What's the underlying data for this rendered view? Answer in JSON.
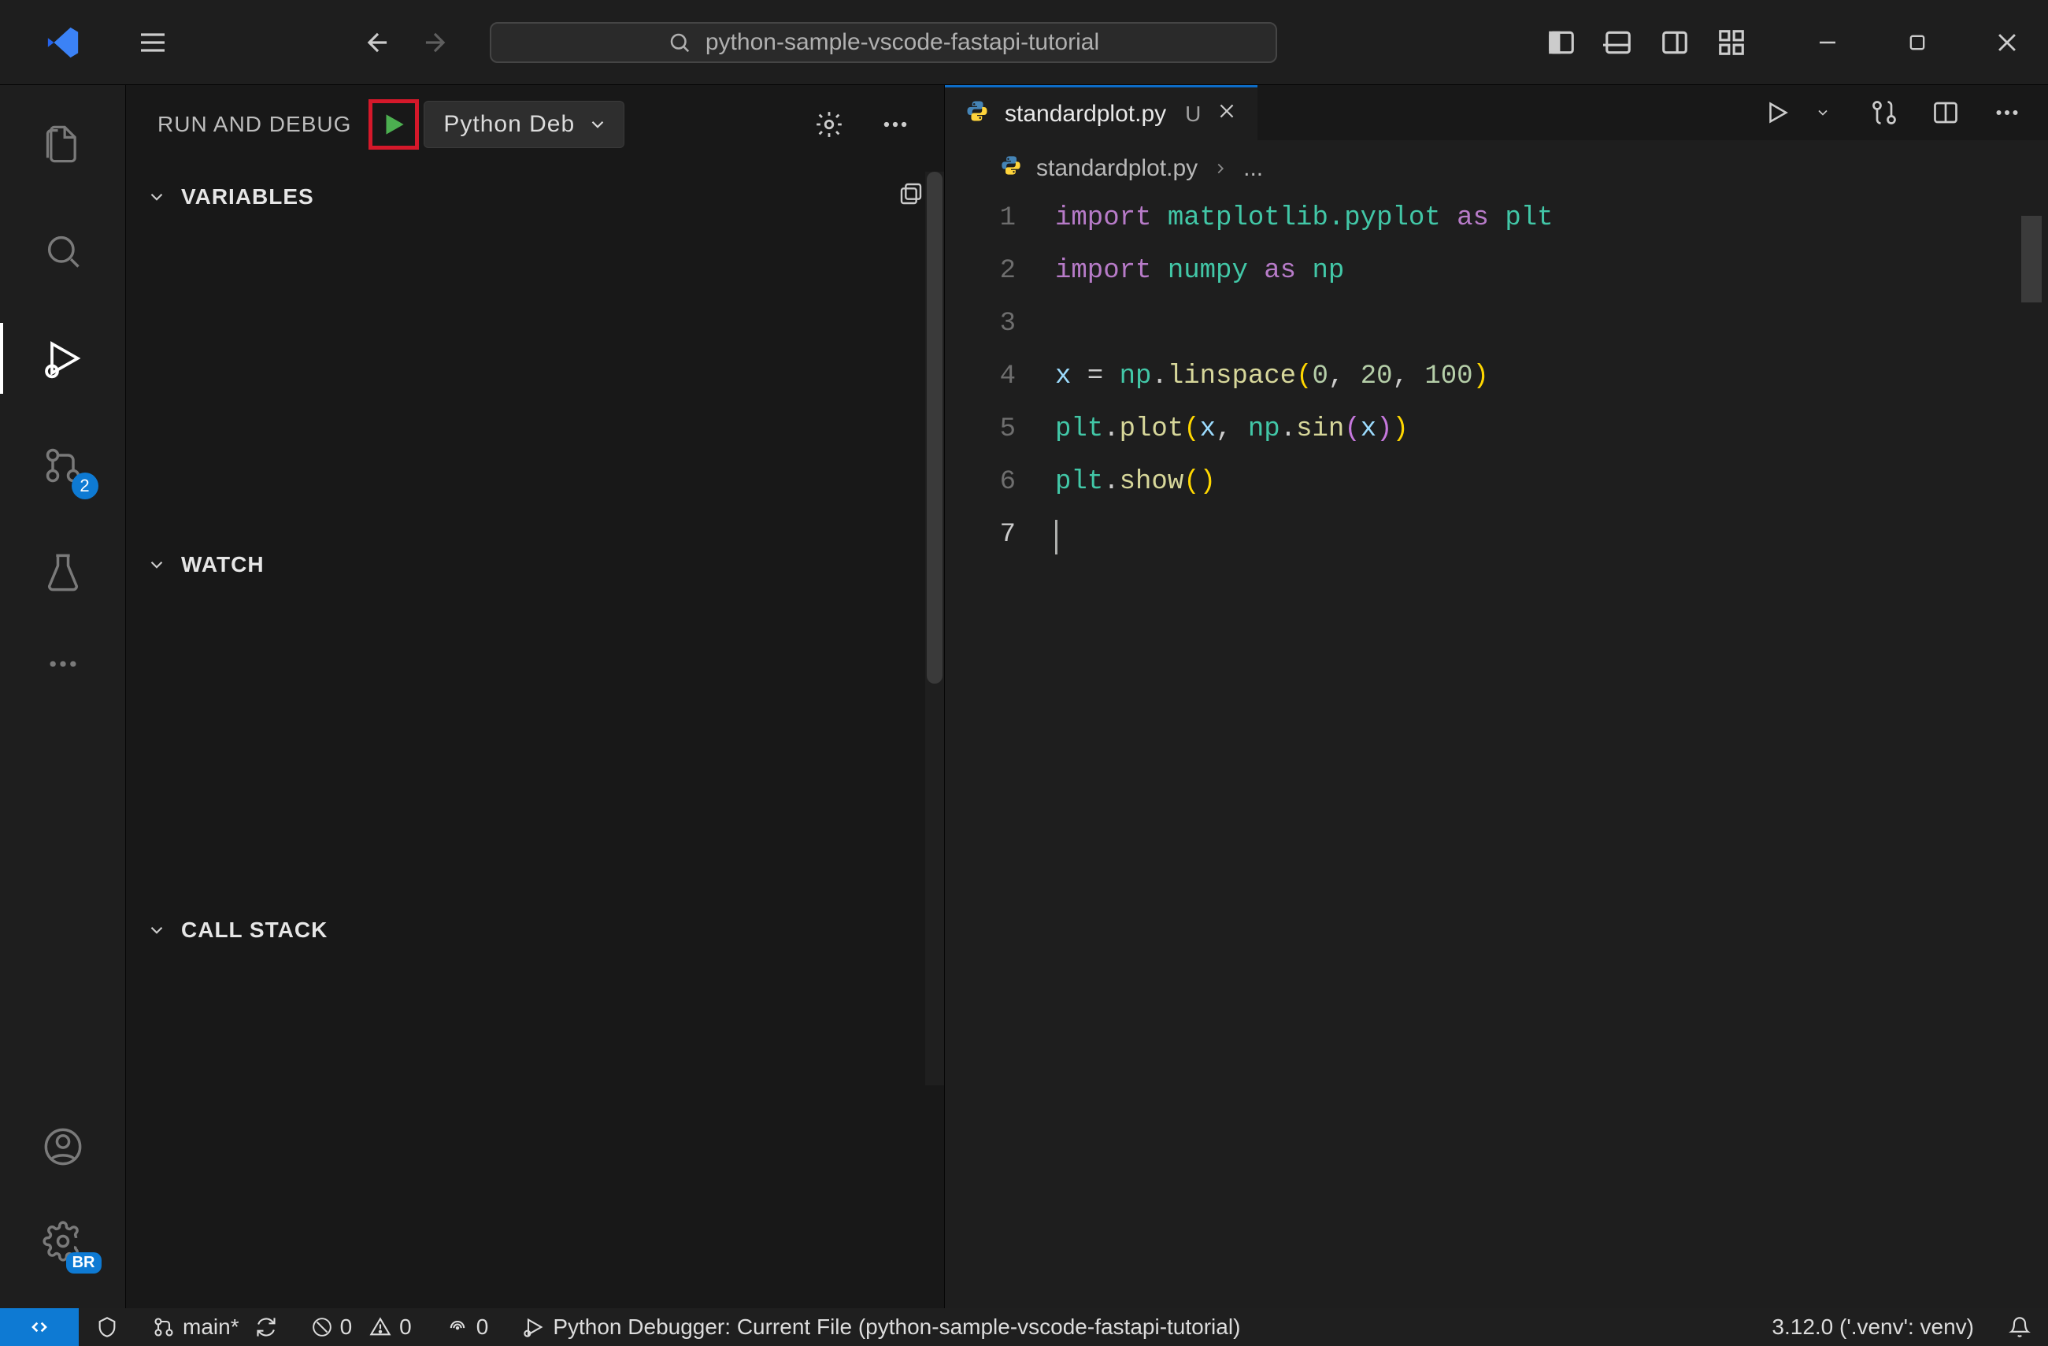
{
  "titlebar": {
    "search_placeholder": "python-sample-vscode-fastapi-tutorial"
  },
  "activity": {
    "scm_badge": "2",
    "settings_tag": "BR"
  },
  "sidebar": {
    "title": "RUN AND DEBUG",
    "config_name": "Python Deb",
    "sections": {
      "variables": "VARIABLES",
      "watch": "WATCH",
      "callstack": "CALL STACK"
    }
  },
  "editor": {
    "tab": {
      "filename": "standardplot.py",
      "modified_marker": "U"
    },
    "breadcrumb": {
      "file": "standardplot.py",
      "more": "..."
    },
    "line_numbers": [
      "1",
      "2",
      "3",
      "4",
      "5",
      "6",
      "7"
    ],
    "code": {
      "l1": {
        "import": "import",
        "module": "matplotlib.pyplot",
        "as": "as",
        "alias": "plt"
      },
      "l2": {
        "import": "import",
        "module": "numpy",
        "as": "as",
        "alias": "np"
      },
      "l4": {
        "x": "x",
        "eq": " = ",
        "np": "np",
        "dot1": ".",
        "linspace": "linspace",
        "op": "(",
        "a": "0",
        "c1": ", ",
        "b": "20",
        "c2": ", ",
        "c": "100",
        "cp": ")"
      },
      "l5": {
        "plt": "plt",
        "dot": ".",
        "plot": "plot",
        "op": "(",
        "x": "x",
        "c1": ", ",
        "np": "np",
        "dot2": ".",
        "sin": "sin",
        "op2": "(",
        "x2": "x",
        "cp2": ")",
        "cp": ")"
      },
      "l6": {
        "plt": "plt",
        "dot": ".",
        "show": "show",
        "op": "(",
        "cp": ")"
      }
    }
  },
  "statusbar": {
    "branch": "main*",
    "errors": "0",
    "warnings": "0",
    "ports": "0",
    "debugger": "Python Debugger: Current File (python-sample-vscode-fastapi-tutorial)",
    "interpreter": "3.12.0 ('.venv': venv)"
  }
}
